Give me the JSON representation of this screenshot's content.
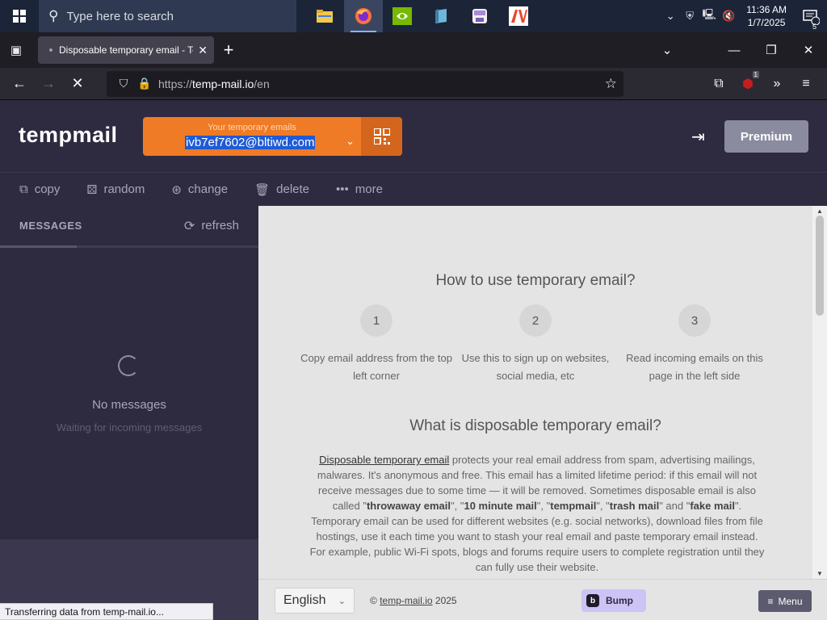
{
  "taskbar": {
    "search_placeholder": "Type here to search",
    "apps": [
      {
        "name": "file-explorer",
        "color": "#f2c94c"
      },
      {
        "name": "firefox",
        "color": "#ff7139"
      },
      {
        "name": "nvidia",
        "color": "#76b900"
      },
      {
        "name": "app-book",
        "color": "#6fb6d9"
      },
      {
        "name": "app-floppy",
        "color": "#a98ad8"
      },
      {
        "name": "app-av",
        "color": "#e8452c"
      }
    ],
    "time": "11:36 AM",
    "date": "1/7/2025",
    "notification_count": "5"
  },
  "browser": {
    "tab_title": "Disposable temporary email - Te",
    "url_scheme": "https://",
    "url_host": "temp-mail.io",
    "url_path": "/en",
    "ublock_badge": "1",
    "status_text": "Transferring data from temp-mail.io..."
  },
  "site": {
    "logo": "tempmail",
    "email_label": "Your temporary emails",
    "email_value": "ivb7ef7602@bltiwd.com",
    "premium_label": "Premium",
    "actions": [
      {
        "label": "copy",
        "icon": "copy-icon",
        "glyph": "⧉"
      },
      {
        "label": "random",
        "icon": "dice-icon",
        "glyph": "⚄"
      },
      {
        "label": "change",
        "icon": "change-icon",
        "glyph": "⊛"
      },
      {
        "label": "delete",
        "icon": "trash-icon",
        "glyph": "🗑"
      },
      {
        "label": "more",
        "icon": "more-icon",
        "glyph": "•••"
      }
    ]
  },
  "messages": {
    "title": "MESSAGES",
    "refresh_label": "refresh",
    "empty_title": "No messages",
    "empty_subtitle": "Waiting for incoming messages"
  },
  "content": {
    "how_title": "How to use temporary email?",
    "steps": [
      {
        "num": "1",
        "text": "Copy email address from the top left corner"
      },
      {
        "num": "2",
        "text": "Use this to sign up on websites, social media, etc"
      },
      {
        "num": "3",
        "text": "Read incoming emails on this page in the left side"
      }
    ],
    "what_title": "What is disposable temporary email?",
    "para_link": "Disposable temporary email",
    "para_1": " protects your real email address from spam, advertising mailings, malwares. It's anonymous and free. This email has a limited lifetime period: if this email will not receive messages due to some time — it will be removed. Sometimes disposable email is also called \"",
    "b1": "throwaway email",
    "t1": "\", \"",
    "b2": "10 minute mail",
    "t2": "\", \"",
    "b3": "tempmail",
    "t3": "\", \"",
    "b4": "trash mail",
    "t4": "\" and \"",
    "b5": "fake mail",
    "para_2": "\". Temporary email can be used for different websites (e.g. social networks), download files from file hostings, use it each time you want to stash your real email and paste temporary email instead. For example, public Wi-Fi spots, blogs and forums require users to complete registration until they can fully use their website."
  },
  "footer": {
    "language": "English",
    "copyright_prefix": "©",
    "copyright_site": "temp-mail.io",
    "copyright_year": "2025",
    "bump_label": "Bump",
    "menu_label": "Menu"
  },
  "colors": {
    "accent_orange": "#ef7b26",
    "header_bg": "#2e2b40",
    "content_bg": "#e4e4e4",
    "selection_blue": "#1e5bd6"
  }
}
